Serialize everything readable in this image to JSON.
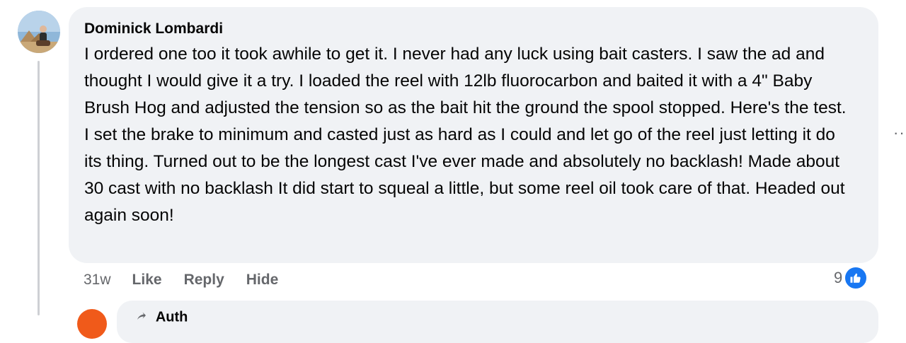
{
  "comment": {
    "author": "Dominick Lombardi",
    "text": "I ordered one too it took awhile to get it. I never had any luck using bait casters. I saw the ad and thought I would give it a try. I loaded the reel with 12lb fluorocarbon and baited it with a 4\" Baby Brush Hog and adjusted the tension so as the bait hit the ground the spool stopped. Here's the test. I set the brake to minimum and casted just as hard as I could and let go of the reel just letting it do its thing. Turned out to be the longest cast I've ever made and absolutely no backlash! Made about 30 cast with no backlash It did start to squeal a little, but some reel oil took care of that. Headed out again soon!",
    "time": "31w",
    "actions": {
      "like": "Like",
      "reply": "Reply",
      "hide": "Hide"
    },
    "reactions": {
      "count": "9",
      "icon": "thumbs-up-icon",
      "color": "#1877f2"
    },
    "more_icon": "more-dots-icon"
  },
  "reply": {
    "author_partial": "Auth"
  },
  "colors": {
    "bubble": "#f0f2f5",
    "meta_text": "#65676b",
    "like_blue": "#1877f2",
    "reply_avatar": "#f05a1a"
  }
}
